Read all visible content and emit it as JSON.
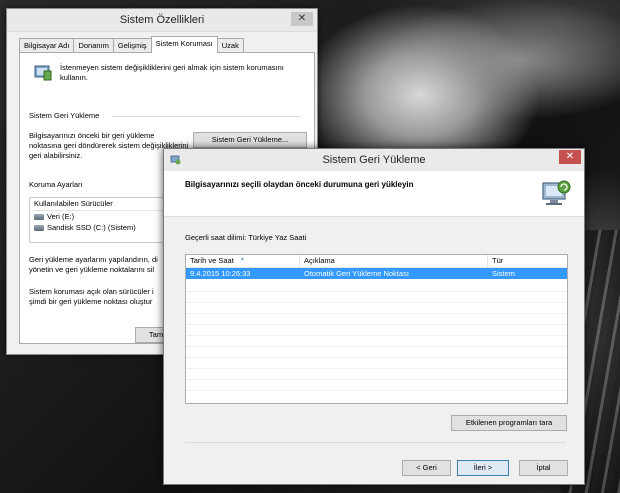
{
  "props_window": {
    "title": "Sistem Özellikleri",
    "close_glyph": "✕",
    "tabs": [
      "Bilgisayar Adı",
      "Donanım",
      "Gelişmiş",
      "Sistem Koruması",
      "Uzak"
    ],
    "intro_text": "İstenmeyen sistem değişikliklerini geri almak için sistem korumasını kullanın.",
    "restore_section_label": "Sistem Geri Yükleme",
    "restore_desc": "Bilgisayarınızı önceki bir geri yükleme noktasına geri döndürerek sistem değişikliklerini geri alabilirsiniz.",
    "restore_button": "Sistem Geri Yükleme...",
    "protection_section_label": "Koruma Ayarları",
    "drives_header": "Kullanılabilen Sürücüler",
    "drives": [
      "Veri (E:)",
      "Sandisk SSD (C:) (Sistem)"
    ],
    "config_text_1": "Geri yükleme ayarlarını yapılandırın, di",
    "config_text_2": "yönetin ve geri yükleme noktalarını sil",
    "create_text_1": "Sistem koruması açık olan sürücüler i",
    "create_text_2": "şimdi bir geri yükleme noktası oluştur",
    "partial_button": "Tam"
  },
  "restore_window": {
    "title": "Sistem Geri Yükleme",
    "close_glyph": "✕",
    "header": "Bilgisayarınızı seçili olaydan önceki durumuna geri yükleyin",
    "timezone": "Geçerli saat dilimi: Türkiye Yaz Saati",
    "columns": [
      "Tarih ve Saat",
      "Açıklama",
      "Tür"
    ],
    "rows": [
      {
        "date": "9.4.2015 10:26:33",
        "desc": "Otomatik Geri Yükleme Noktası",
        "type": "Sistem"
      }
    ],
    "scan_button": "Etkilenen programları tara",
    "back_button": "< Geri",
    "next_button": "İleri >",
    "cancel_button": "İptal"
  }
}
